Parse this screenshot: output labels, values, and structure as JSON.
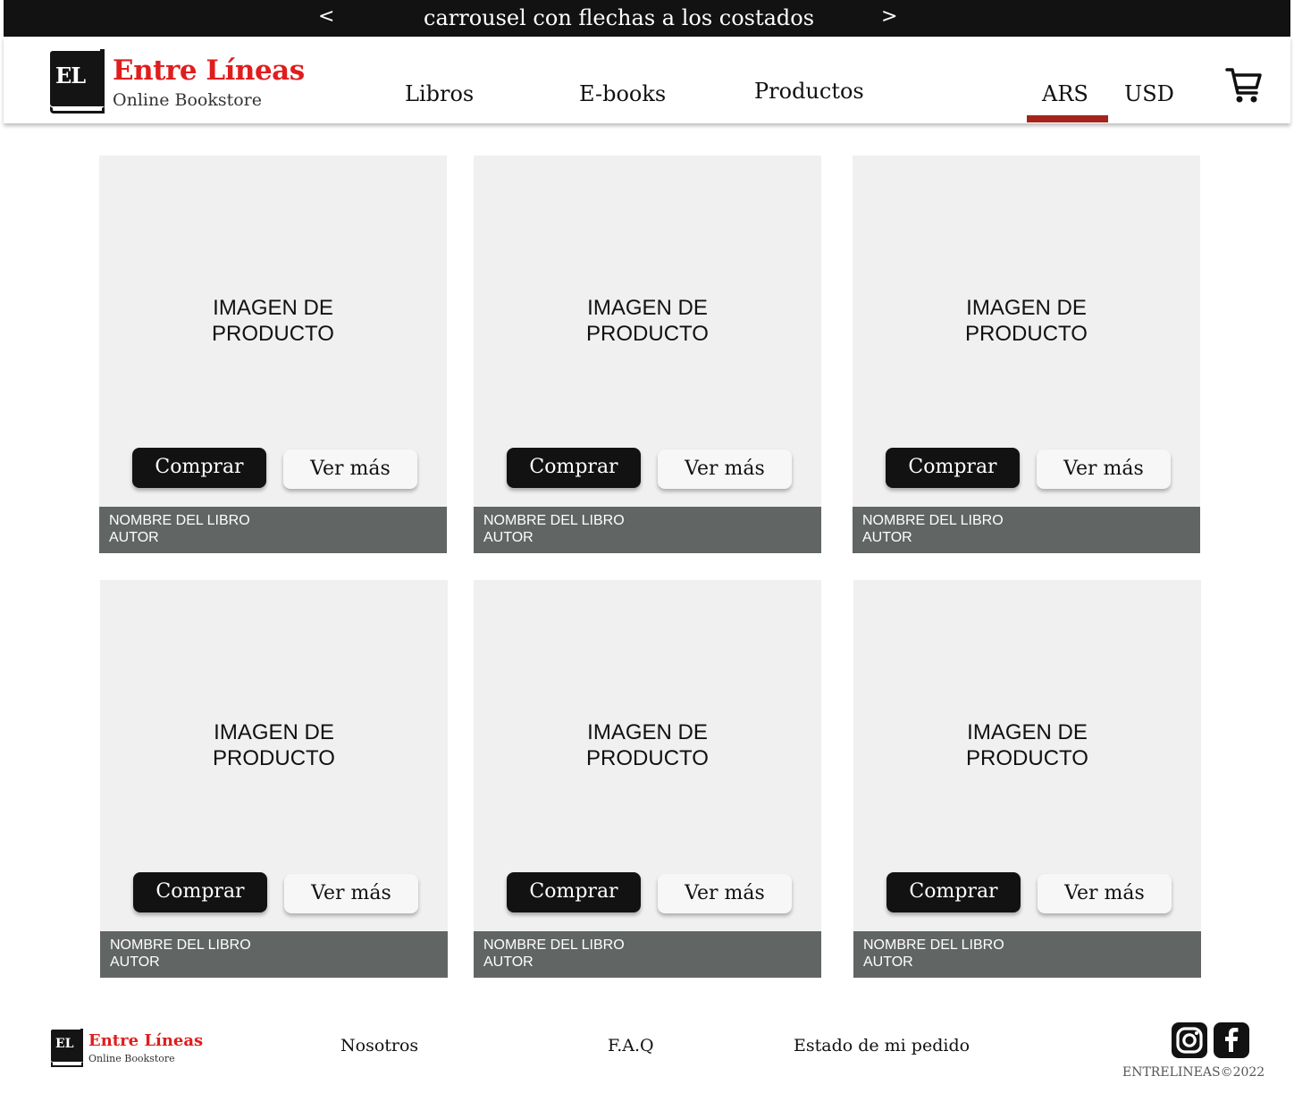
{
  "carousel": {
    "prev_label": "<",
    "text": "carrousel con flechas a los costados",
    "next_label": ">"
  },
  "brand": {
    "mark": "EL",
    "name": "Entre Líneas",
    "tagline": "Online Bookstore",
    "accent_color": "#e01d1d"
  },
  "nav": {
    "items": [
      {
        "label": "Libros"
      },
      {
        "label": "E-books"
      },
      {
        "label": "Productos"
      }
    ]
  },
  "currency": {
    "options": [
      "ARS",
      "USD"
    ],
    "selected": "ARS",
    "indicator_color": "#a5231d"
  },
  "cart": {
    "icon": "cart-icon"
  },
  "products": [
    {
      "image_label_1": "IMAGEN DE",
      "image_label_2": "PRODUCTO",
      "buy_label": "Comprar",
      "more_label": "Ver más",
      "title": "NOMBRE DEL LIBRO",
      "author": "AUTOR"
    },
    {
      "image_label_1": "IMAGEN DE",
      "image_label_2": "PRODUCTO",
      "buy_label": "Comprar",
      "more_label": "Ver más",
      "title": "NOMBRE DEL LIBRO",
      "author": "AUTOR"
    },
    {
      "image_label_1": "IMAGEN DE",
      "image_label_2": "PRODUCTO",
      "buy_label": "Comprar",
      "more_label": "Ver más",
      "title": "NOMBRE DEL LIBRO",
      "author": "AUTOR"
    },
    {
      "image_label_1": "IMAGEN DE",
      "image_label_2": "PRODUCTO",
      "buy_label": "Comprar",
      "more_label": "Ver más",
      "title": "NOMBRE DEL LIBRO",
      "author": "AUTOR"
    },
    {
      "image_label_1": "IMAGEN DE",
      "image_label_2": "PRODUCTO",
      "buy_label": "Comprar",
      "more_label": "Ver más",
      "title": "NOMBRE DEL LIBRO",
      "author": "AUTOR"
    },
    {
      "image_label_1": "IMAGEN DE",
      "image_label_2": "PRODUCTO",
      "buy_label": "Comprar",
      "more_label": "Ver más",
      "title": "NOMBRE DEL LIBRO",
      "author": "AUTOR"
    }
  ],
  "footer": {
    "links": [
      {
        "label": "Nosotros"
      },
      {
        "label": "F.A.Q"
      },
      {
        "label": "Estado de mi pedido"
      }
    ],
    "social": [
      {
        "icon": "instagram-icon"
      },
      {
        "icon": "facebook-icon"
      }
    ],
    "copyright": "ENTRELINEAS©2022"
  }
}
